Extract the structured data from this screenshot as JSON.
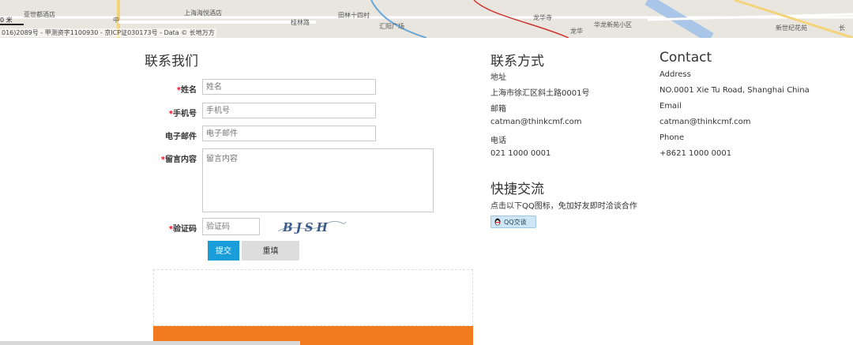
{
  "map": {
    "scale": "0 米",
    "copyright": "016)2089号 - 甲测资字1100930 - 京ICP证030173号 - Data © 长地万方",
    "labels": [
      "亚世都酒店",
      "中",
      "上海海悦酒店",
      "桂林路",
      "田林十四村",
      "汇阳广场",
      "龙华寺",
      "龙华",
      "华龙新苑小区",
      "新世纪花苑",
      "长"
    ]
  },
  "form": {
    "title": "联系我们",
    "required_mark": "*",
    "name_label": "姓名",
    "name_placeholder": "姓名",
    "phone_label": "手机号",
    "phone_placeholder": "手机号",
    "email_label": "电子邮件",
    "email_placeholder": "电子邮件",
    "message_label": "留言内容",
    "message_placeholder": "留言内容",
    "captcha_label": "验证码",
    "captcha_placeholder": "验证码",
    "captcha_text": "BJSH",
    "submit_label": "提交",
    "reset_label": "重填"
  },
  "contact_cn": {
    "title": "联系方式",
    "address_label": "地址",
    "address_value": "上海市徐汇区斜土路0001号",
    "email_label": "邮箱",
    "email_value": "catman@thinkcmf.com",
    "phone_label": "电话",
    "phone_value": "021 1000 0001"
  },
  "contact_en": {
    "title": "Contact",
    "address_label": "Address",
    "address_value": "NO.0001 Xie Tu Road, Shanghai China",
    "email_label": "Email",
    "email_value": "catman@thinkcmf.com",
    "phone_label": "Phone",
    "phone_value": "+8621 1000 0001"
  },
  "quick": {
    "title": "快捷交流",
    "desc": "点击以下QQ图标，免加好友即时洽谈合作",
    "qq_button": "QQ交谈"
  },
  "colors": {
    "submit": "#1a9ed9",
    "comment_bar": "#f37b1f",
    "required": "#e12"
  }
}
